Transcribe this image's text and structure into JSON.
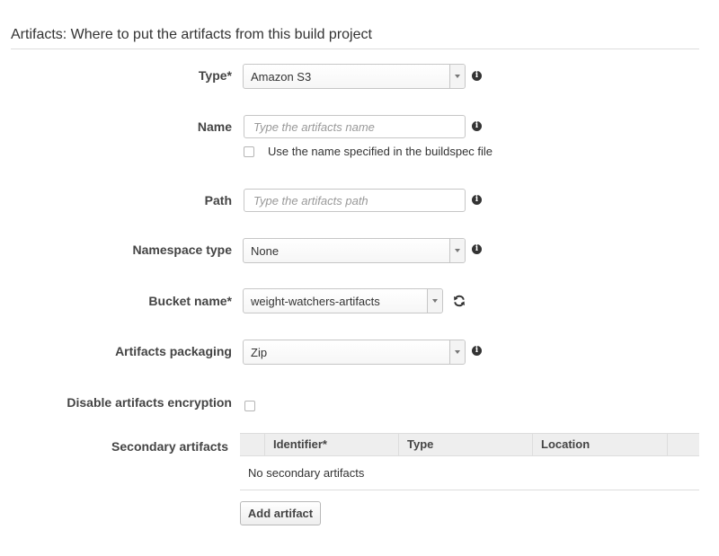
{
  "section": {
    "title": "Artifacts: Where to put the artifacts from this build project"
  },
  "fields": {
    "type": {
      "label": "Type*",
      "value": "Amazon S3"
    },
    "name": {
      "label": "Name",
      "placeholder": "Type the artifacts name",
      "value": "",
      "buildspec_checkbox_label": "Use the name specified in the buildspec file"
    },
    "path": {
      "label": "Path",
      "placeholder": "Type the artifacts path",
      "value": ""
    },
    "namespace_type": {
      "label": "Namespace type",
      "value": "None"
    },
    "bucket_name": {
      "label": "Bucket name*",
      "value": "weight-watchers-artifacts"
    },
    "artifacts_packaging": {
      "label": "Artifacts packaging",
      "value": "Zip"
    },
    "disable_encryption": {
      "label": "Disable artifacts encryption"
    }
  },
  "secondary_artifacts": {
    "label": "Secondary artifacts",
    "columns": [
      "Identifier*",
      "Type",
      "Location"
    ],
    "empty_text": "No secondary artifacts",
    "add_button_label": "Add artifact"
  },
  "icons": {
    "info": "info-icon",
    "refresh": "refresh-icon",
    "dropdown": "caret-down-icon"
  },
  "info_glyph": "i"
}
